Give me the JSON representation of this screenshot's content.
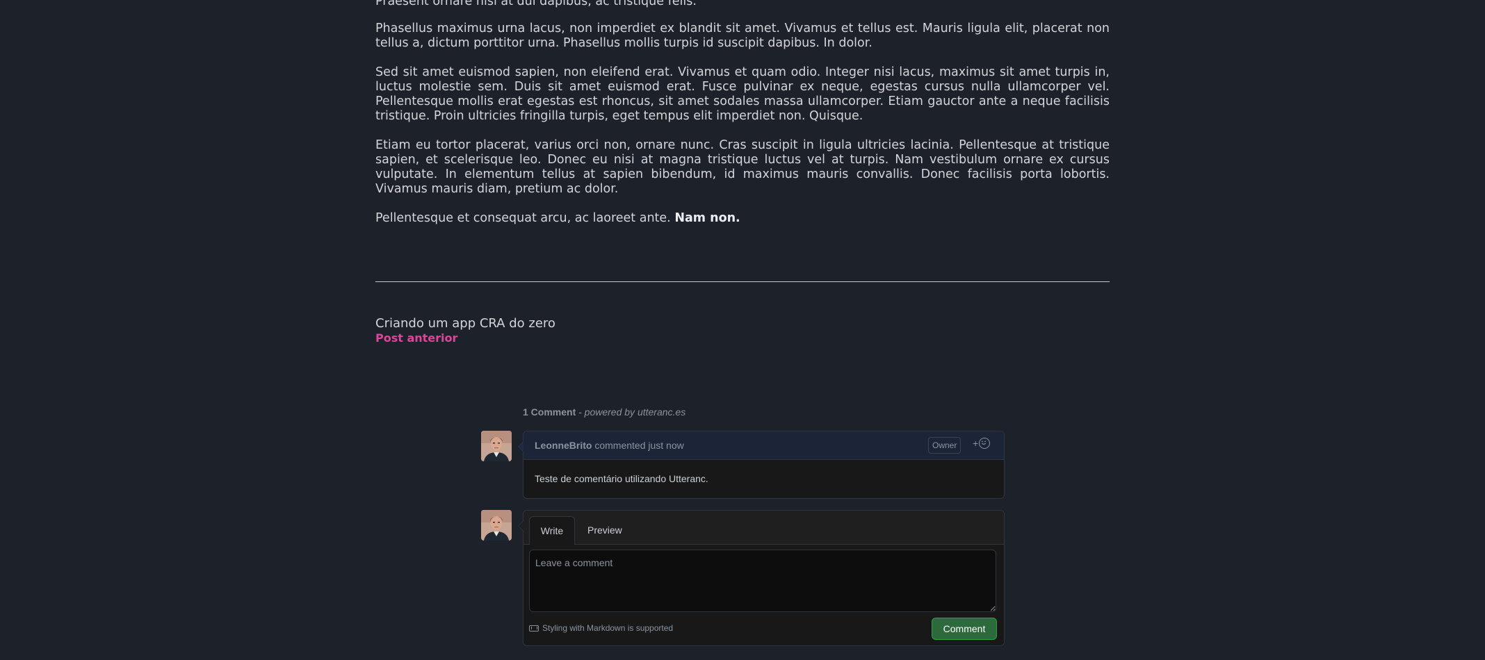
{
  "article": {
    "partial_first_line": "Praesent ornare nisi at dui dapibus, ac tristique felis.",
    "paragraphs": [
      "Phasellus maximus urna lacus, non imperdiet ex blandit sit amet. Vivamus et tellus est. Mauris ligula elit, placerat non tellus a, dictum porttitor urna. Phasellus mollis turpis id suscipit dapibus. In dolor.",
      "Sed sit amet euismod sapien, non eleifend erat. Vivamus et quam odio. Integer nisi lacus, maximus sit amet turpis in, luctus molestie sem. Duis sit amet euismod erat. Fusce pulvinar ex neque, egestas cursus nulla ullamcorper vel. Pellentesque mollis erat egestas est rhoncus, sit amet sodales massa ullamcorper. Etiam gauctor ante a neque facilisis tristique. Proin ultricies fringilla turpis, eget tempus elit imperdiet non. Quisque.",
      "Etiam eu tortor placerat, varius orci non, ornare nunc. Cras suscipit in ligula ultricies lacinia. Pellentesque at tristique sapien, et scelerisque leo. Donec eu nisi at magna tristique luctus vel at turpis. Nam vestibulum ornare ex cursus vulputate. In elementum tellus at sapien bibendum, id maximus mauris convallis. Donec facilisis porta lobortis. Vivamus mauris diam, pretium ac dolor."
    ],
    "last_paragraph": "Pellentesque et consequat arcu, ac laoreet ante.",
    "last_bold": "Nam non."
  },
  "navigation": {
    "previous_title": "Criando um app CRA do zero",
    "previous_label": "Post anterior"
  },
  "comments": {
    "count_label": "1 Comment",
    "powered_by": " - powered by utteranc.es",
    "items": [
      {
        "author": "LeonneBrito",
        "meta": " commented just now",
        "badge": "Owner",
        "reaction_label": "+",
        "body": "Teste de comentário utilizando Utteranc."
      }
    ],
    "form": {
      "tab_write": "Write",
      "tab_preview": "Preview",
      "placeholder": "Leave a comment",
      "markdown_note": "Styling with Markdown is supported",
      "submit_label": "Comment"
    }
  },
  "colors": {
    "background": "#1c212a",
    "link_accent": "#e0449a",
    "submit_button": "#2d6a3b"
  }
}
